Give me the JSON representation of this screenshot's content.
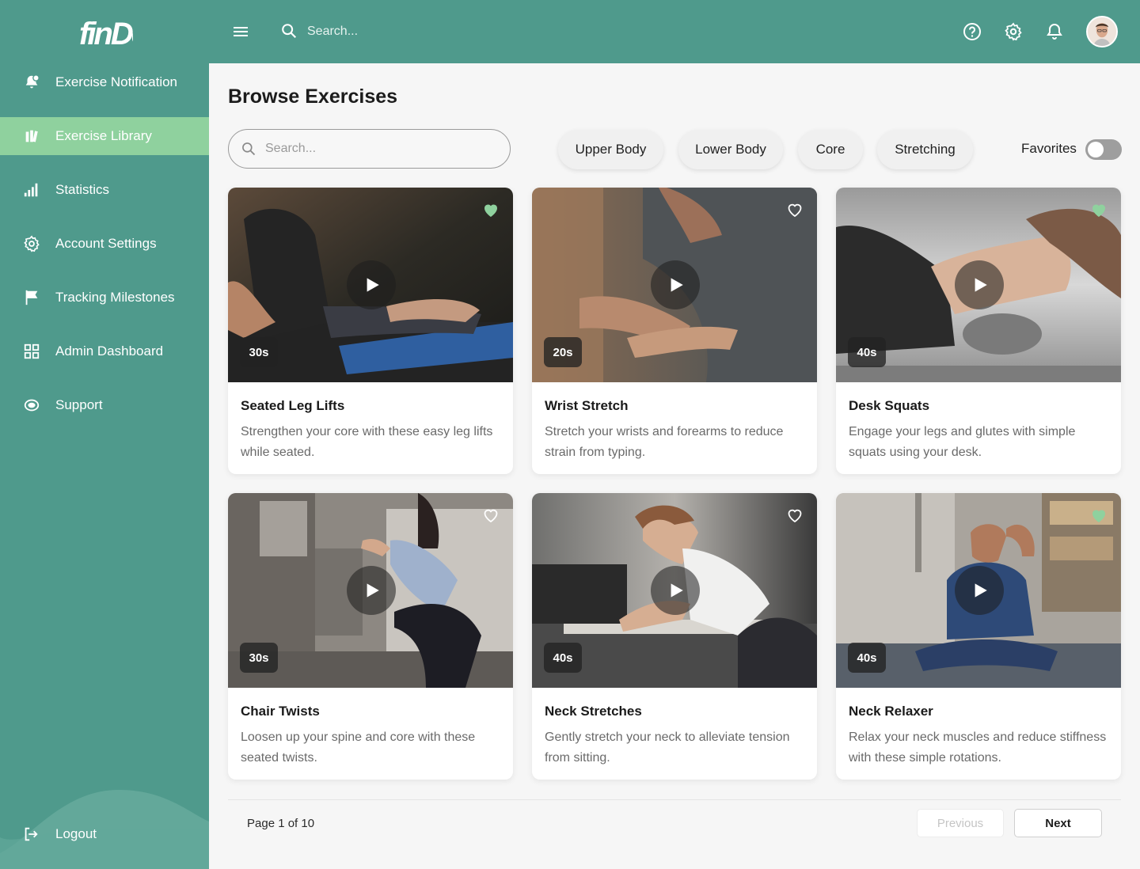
{
  "app": {
    "logo_text": "finDe"
  },
  "colors": {
    "primary": "#4f9a8c",
    "active_nav": "#8fd19e",
    "favorite_heart": "#8fd19e"
  },
  "sidebar": {
    "items": [
      {
        "label": "Exercise Notification",
        "icon": "bell-alert-icon",
        "active": false
      },
      {
        "label": "Exercise Library",
        "icon": "library-books-icon",
        "active": true
      },
      {
        "label": "Statistics",
        "icon": "bar-signal-icon",
        "active": false
      },
      {
        "label": "Account Settings",
        "icon": "gear-icon",
        "active": false
      },
      {
        "label": "Tracking Milestones",
        "icon": "flag-icon",
        "active": false
      },
      {
        "label": "Admin Dashboard",
        "icon": "grid-icon",
        "active": false
      },
      {
        "label": "Support",
        "icon": "support-icon",
        "active": false
      }
    ],
    "logout_label": "Logout"
  },
  "topbar": {
    "search_placeholder": "Search...",
    "icons": [
      "help-icon",
      "gear-icon",
      "bell-icon",
      "avatar"
    ]
  },
  "main": {
    "title": "Browse Exercises",
    "search_placeholder": "Search...",
    "filters": [
      "Upper Body",
      "Lower Body",
      "Core",
      "Stretching"
    ],
    "favorites_label": "Favorites",
    "favorites_on": false
  },
  "cards": [
    {
      "title": "Seated Leg Lifts",
      "description": "Strengthen your core with these easy leg lifts while seated.",
      "duration": "30s",
      "favorite": true
    },
    {
      "title": "Wrist Stretch",
      "description": "Stretch your wrists and forearms to reduce strain from typing.",
      "duration": "20s",
      "favorite": false
    },
    {
      "title": "Desk Squats",
      "description": "Engage your legs and glutes with simple squats using your desk.",
      "duration": "40s",
      "favorite": true
    },
    {
      "title": "Chair Twists",
      "description": "Loosen up your spine and core with these seated twists.",
      "duration": "30s",
      "favorite": false
    },
    {
      "title": "Neck Stretches",
      "description": "Gently stretch your neck to alleviate tension from sitting.",
      "duration": "40s",
      "favorite": false
    },
    {
      "title": "Neck Relaxer",
      "description": "Relax your neck muscles and reduce stiffness with these simple rotations.",
      "duration": "40s",
      "favorite": true
    }
  ],
  "pagination": {
    "info": "Page 1 of 10",
    "previous_label": "Previous",
    "next_label": "Next"
  }
}
